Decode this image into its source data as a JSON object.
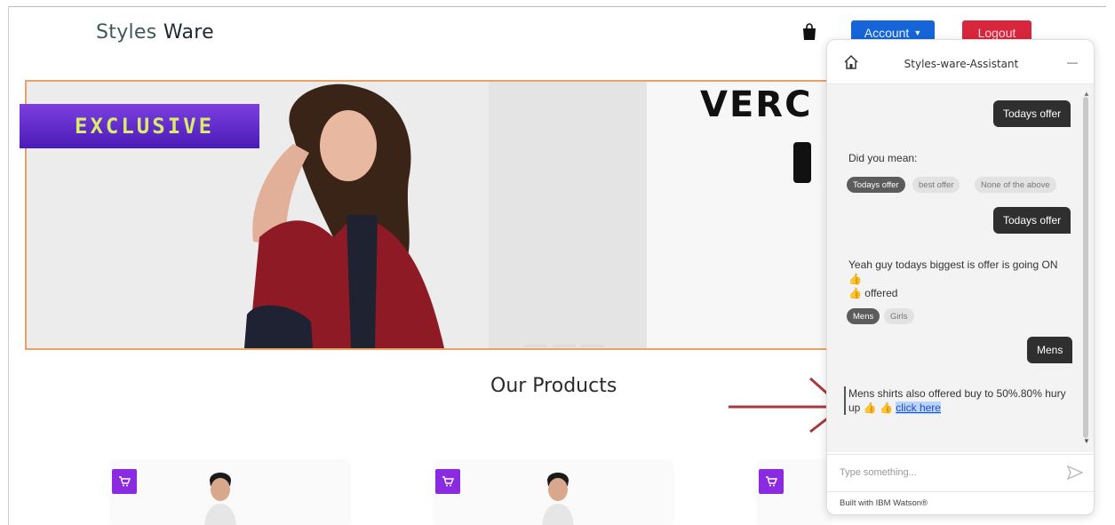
{
  "header": {
    "brand_part1": "Styles",
    "brand_part2": "Ware",
    "account_label": "Account",
    "logout_label": "Logout"
  },
  "hero": {
    "badge_text": "EXCLUSIVE",
    "headline": "VERC"
  },
  "products": {
    "title": "Our Products"
  },
  "chat": {
    "title": "Styles-ware-Assistant",
    "messages": {
      "user_1": "Todays offer",
      "bot_1": "Did you mean:",
      "chips_1": [
        "Todays offer",
        "best offer",
        "None of the above"
      ],
      "user_2": "Todays offer",
      "bot_2_line1": "Yeah guy todays biggest is offer is going ON",
      "bot_2_line2": "offered",
      "chips_2": [
        "Mens",
        "Girls"
      ],
      "user_3": "Mens",
      "bot_3_line1": "Mens shirts also offered buy to 50%.80% hury",
      "bot_3_line2": "up",
      "bot_3_link": "click here"
    },
    "input_placeholder": "Type something...",
    "footer": "Built with IBM Watson®"
  },
  "colors": {
    "account_blue": "#1565d8",
    "logout_red": "#d7263d",
    "badge_purple": "#7d3fe0",
    "cart_purple": "#8a2be2"
  }
}
